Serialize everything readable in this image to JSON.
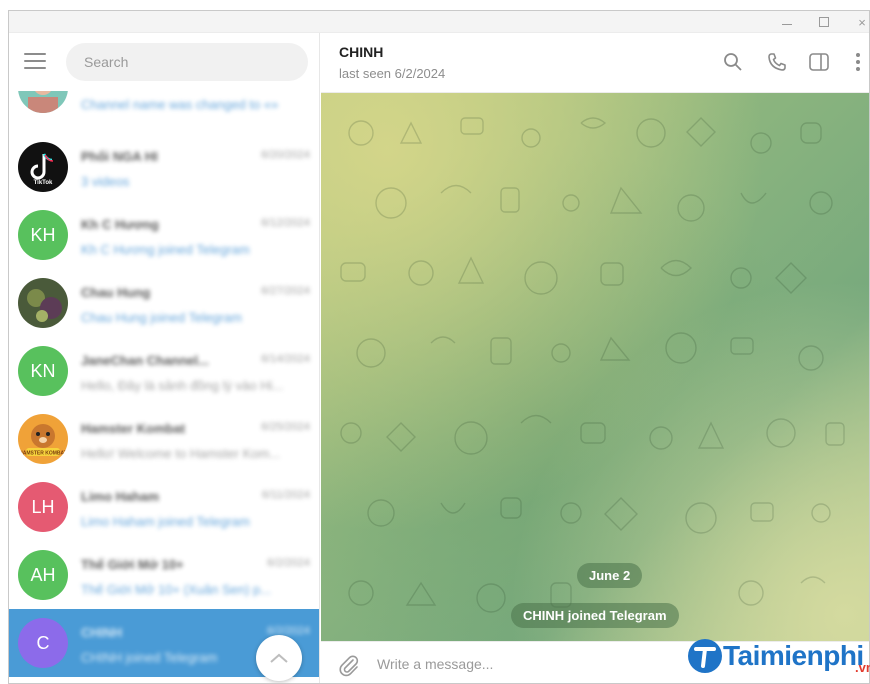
{
  "window": {
    "controls": {
      "minimize": "",
      "maximize": "",
      "close": "×"
    }
  },
  "sidebar": {
    "search_placeholder": "Search",
    "chats": [
      {
        "avatar_text": "",
        "avatar_color": "#7fc7b9",
        "name": "",
        "date": "",
        "preview": "Channel name was changed to «»",
        "preview_style": "blue"
      },
      {
        "avatar_text": "TikTok",
        "avatar_color": "#111111",
        "name": "Phối NGA HI",
        "date": "6/20/2024",
        "preview": "3 videos",
        "preview_style": "blue"
      },
      {
        "avatar_text": "KH",
        "avatar_color": "#58c15d",
        "name": "Kh C Hương",
        "date": "6/12/2024",
        "preview": "Kh C Hương joined Telegram",
        "preview_style": "blue"
      },
      {
        "avatar_text": "",
        "avatar_color": "#4a5a3a",
        "name": "Chau Hung",
        "date": "6/27/2024",
        "preview": "Chau Hung joined Telegram",
        "preview_style": "blue"
      },
      {
        "avatar_text": "KN",
        "avatar_color": "#58c15d",
        "name": "JaneChan Channel...",
        "date": "6/14/2024",
        "preview": "Hello, Đây là sảnh đồng lý vào Hi...",
        "preview_style": "gray"
      },
      {
        "avatar_text": "HAMSTER KOMBAT",
        "avatar_color": "#f0a238",
        "name": "Hamster Kombat",
        "date": "6/25/2024",
        "preview": "Hello! Welcome to Hamster Kom...",
        "preview_style": "gray"
      },
      {
        "avatar_text": "LH",
        "avatar_color": "#e55a72",
        "name": "Limo Haham",
        "date": "6/11/2024",
        "preview": "Limo Haham joined Telegram",
        "preview_style": "blue"
      },
      {
        "avatar_text": "AH",
        "avatar_color": "#58c15d",
        "name": "Thế Giới Mở 10+",
        "date": "6/2/2024",
        "preview": "Thế Giới Mở 10+ (Xuân Sen) p...",
        "preview_style": "blue"
      },
      {
        "avatar_text": "C",
        "avatar_color": "#8c6bea",
        "name": "CHINH",
        "date": "6/2/2024",
        "preview": "CHINH joined Telegram",
        "preview_style": "blue",
        "active": true
      }
    ]
  },
  "chat": {
    "title": "CHINH",
    "status": "last seen 6/2/2024",
    "date_label": "June 2",
    "service_message": "CHINH joined Telegram",
    "composer_placeholder": "Write a message..."
  },
  "watermark": {
    "text": "Taimienphi",
    "suffix": ".vn"
  }
}
